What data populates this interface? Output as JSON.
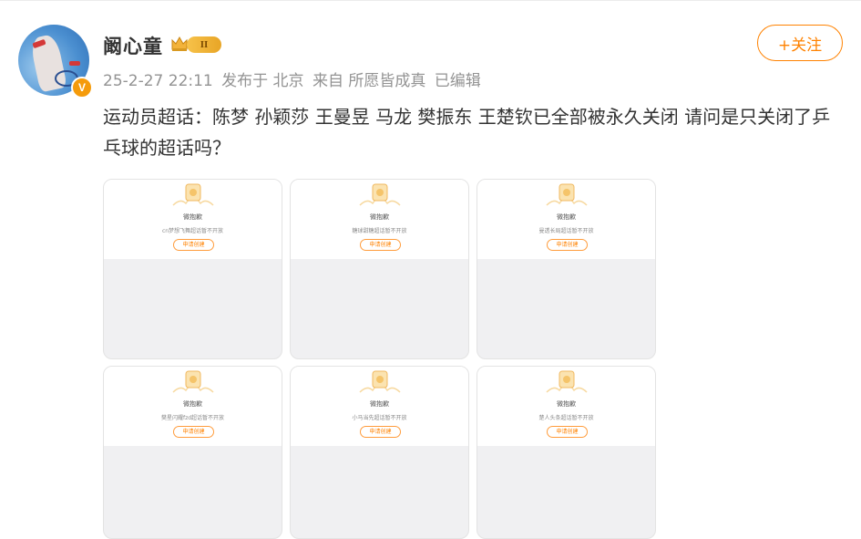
{
  "post": {
    "username": "阚心童",
    "level": "II",
    "verified_mark": "V",
    "meta": {
      "time": "25-2-27 22:11",
      "location": "发布于 北京",
      "source": "来自 所愿皆成真",
      "edited": "已编辑"
    },
    "follow_label": "+关注",
    "content": "运动员超话：陈梦 孙颖莎 王曼昱 马龙 樊振东 王楚钦已全部被永久关闭 请问是只关闭了乒乓球的超话吗？"
  },
  "cards": [
    {
      "title": "微抱歉",
      "note": "cn梦想飞舞超话暂不开放",
      "button": "申请创建"
    },
    {
      "title": "微抱歉",
      "note": "糖球甜糖超话暂不开放",
      "button": "申请创建"
    },
    {
      "title": "微抱歉",
      "note": "曼透长局超话暂不开放",
      "button": "申请创建"
    },
    {
      "title": "微抱歉",
      "note": "樊星闪耀fzd超话暂不开放",
      "button": "申请创建"
    },
    {
      "title": "微抱歉",
      "note": "小马当先超话暂不开放",
      "button": "申请创建"
    },
    {
      "title": "微抱歉",
      "note": "楚人头条超话暂不开放",
      "button": "申请创建"
    }
  ],
  "icons": {
    "avatar": "avatar-photo",
    "verified": "verified-badge-icon",
    "crown": "crown-icon",
    "card_deco": "sad-face-illustration-icon"
  },
  "colors": {
    "accent": "#ff8200",
    "meta_text": "#939393",
    "verified": "#f59b0b"
  }
}
